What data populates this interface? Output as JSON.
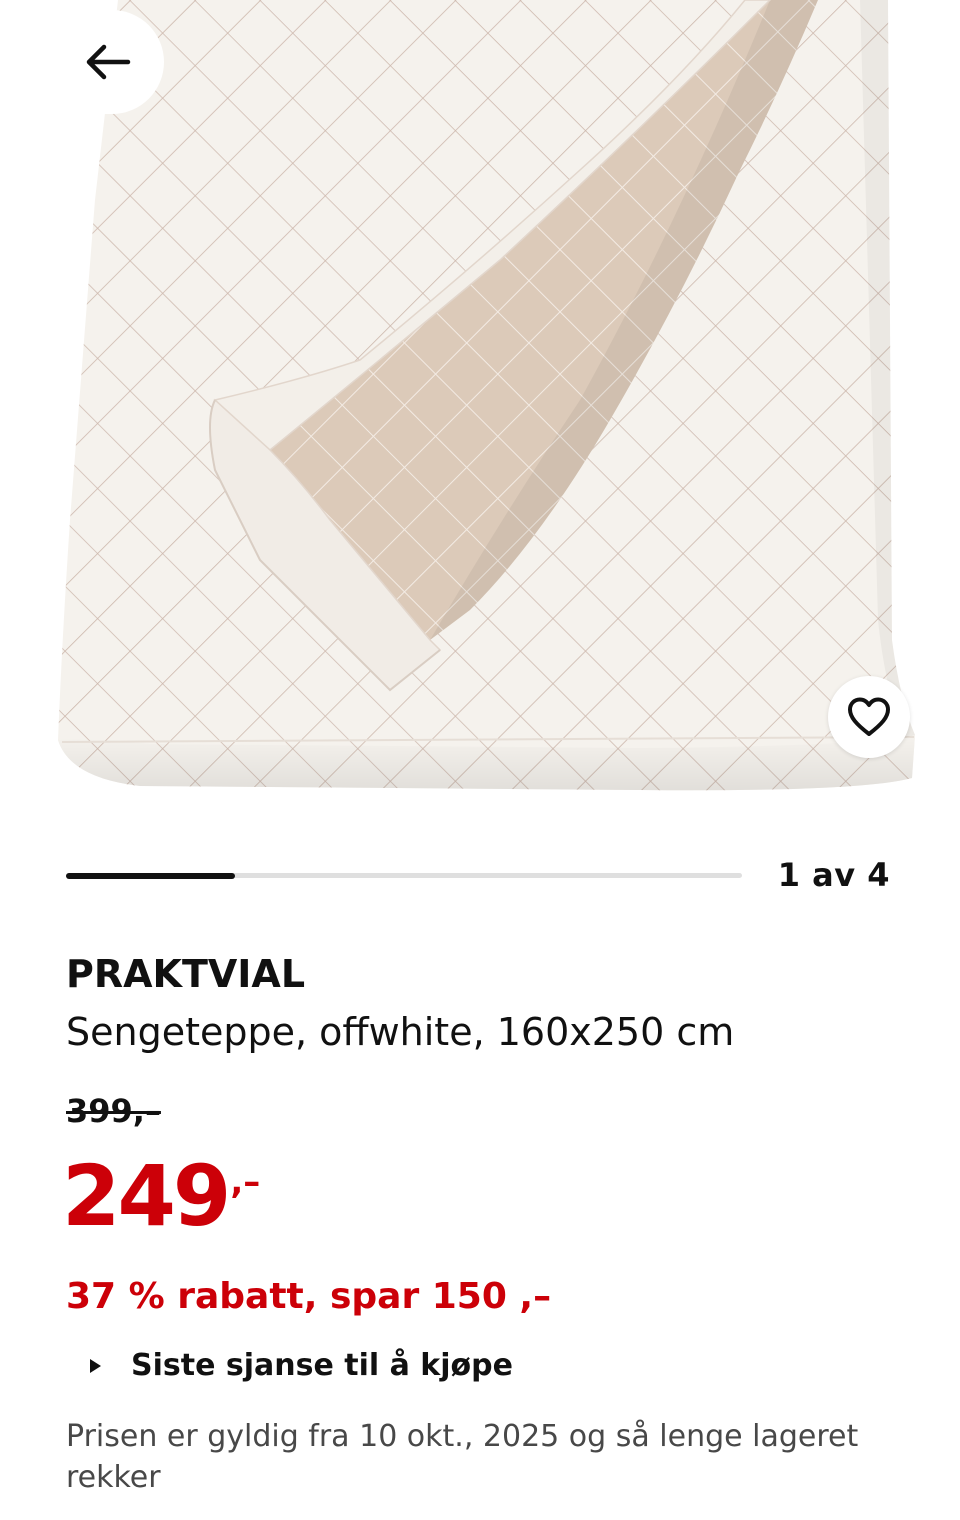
{
  "navigation": {
    "back_icon": "arrow-left-icon",
    "favorite_icon": "heart-outline-icon"
  },
  "gallery": {
    "current_index": 1,
    "total": 4,
    "counter_text": "1 av 4",
    "progress_fraction": 0.25
  },
  "product": {
    "name": "PRAKTVIAL",
    "description": "Sengeteppe, offwhite, 160x250 cm"
  },
  "pricing": {
    "old_price": "399,–",
    "current_price_integer": "249",
    "current_price_suffix": ",–",
    "discount_text": "37 % rabatt, spar 150 ,–",
    "last_chance_label": "Siste sjanse til å kjøpe",
    "validity_text": "Prisen er gyldig fra 10 okt., 2025 og så lenge lageret rekker"
  },
  "colors": {
    "price_red": "#cc0008",
    "text_dark": "#111111",
    "text_muted": "#484848",
    "progress_track": "#dfdfdf",
    "blanket_white": "#f4f1ec",
    "blanket_beige": "#ddc9bc"
  }
}
